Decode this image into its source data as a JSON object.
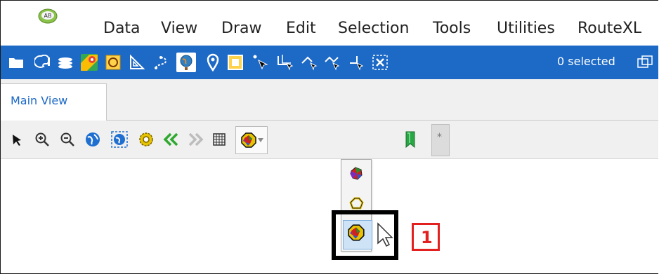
{
  "menubar": {
    "items": [
      {
        "label": "Data"
      },
      {
        "label": "View"
      },
      {
        "label": "Draw"
      },
      {
        "label": "Edit"
      },
      {
        "label": "Selection"
      },
      {
        "label": "Tools"
      },
      {
        "label": "Utilities"
      },
      {
        "label": "RouteXL"
      }
    ]
  },
  "toolbar": {
    "selection_count": "0 selected",
    "icons": [
      "folder-icon",
      "palette-icon",
      "layers-icon",
      "google-maps-icon",
      "draw-shape-icon",
      "ruler-icon",
      "route-icon",
      "globe-icon",
      "map-pin-icon",
      "polygon-select-icon",
      "select-point-icon",
      "node-edit-icon",
      "node-add-icon",
      "node-move-icon",
      "node-delete-icon",
      "deselect-icon",
      "window-icon"
    ]
  },
  "tabs": [
    {
      "label": "Main View"
    }
  ],
  "map_toolbar": {
    "icons": [
      "pointer-icon",
      "zoom-in-icon",
      "zoom-out-icon",
      "globe-view-icon",
      "globe-extent-icon",
      "settings-icon",
      "back-icon",
      "forward-icon",
      "grid-icon",
      "territory-style-icon",
      "chevron-down-icon",
      "bookmark-icon"
    ],
    "star_tab": "*"
  },
  "dropdown": {
    "options": [
      "territory-fill-icon",
      "territory-outline-icon",
      "territory-fill-outline-icon"
    ],
    "selected_index": 2
  },
  "annotation": {
    "number": "1"
  },
  "colors": {
    "toolbar_blue": "#1d69c6",
    "highlight_red": "#e32020"
  }
}
